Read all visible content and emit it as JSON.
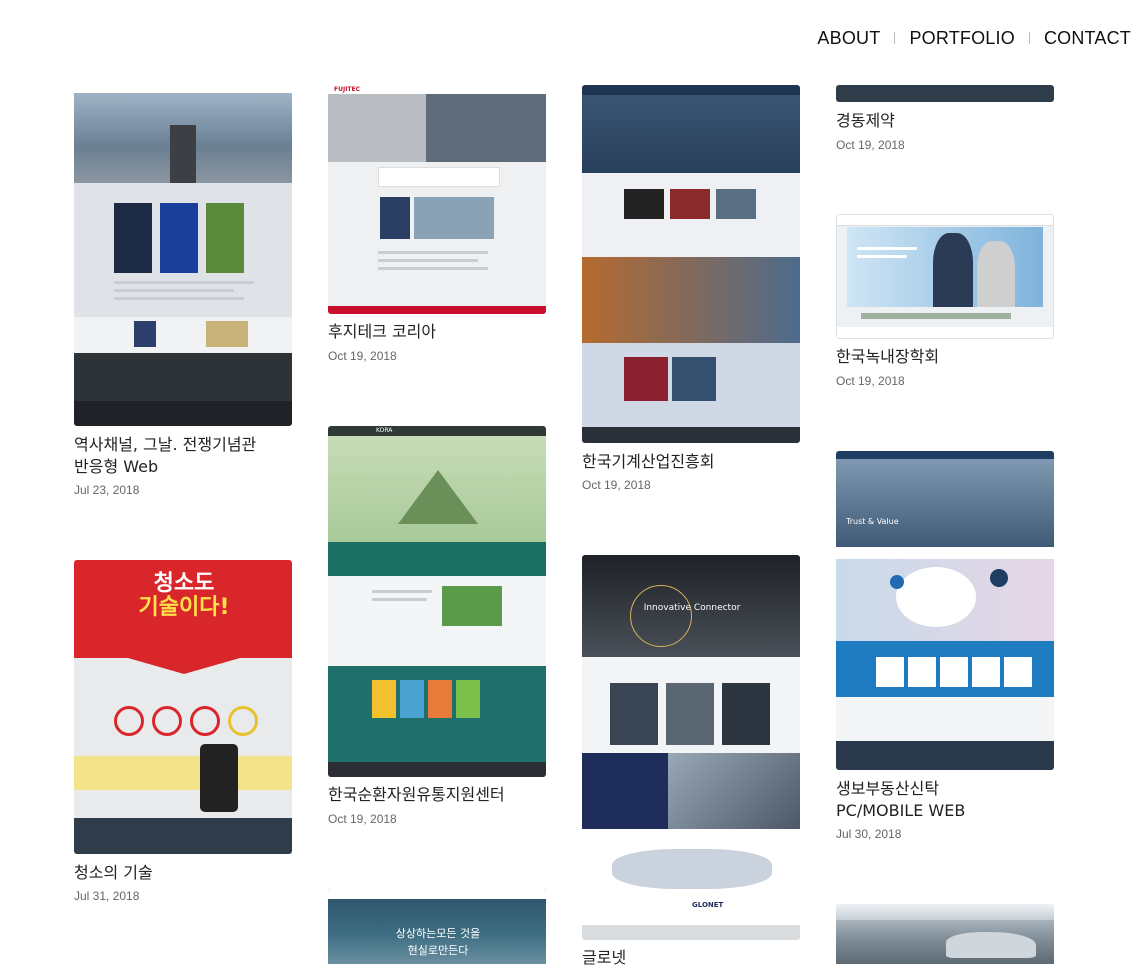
{
  "nav": {
    "about": "ABOUT",
    "portfolio": "PORTFOLIO",
    "contact": "CONTACT"
  },
  "cards": [
    {
      "title": "역사채널, 그날. 전쟁기념관\n반응형 Web",
      "date": "Jul 23, 2018"
    },
    {
      "title": "청소의 기술",
      "date": "Jul 31, 2018",
      "thumb_text": [
        "청소도",
        "기술이다!"
      ]
    },
    {
      "title": "후지테크 코리아",
      "date": "Oct 19, 2018",
      "thumb_text": [
        "FUJITEC"
      ]
    },
    {
      "title": "한국순환자원유통지원센터",
      "date": "Oct 19, 2018",
      "thumb_text": [
        "KORA"
      ]
    },
    {
      "title": "",
      "date": "",
      "thumb_text": [
        "상상하는모든 것을",
        "현실로만든다"
      ]
    },
    {
      "title": "한국기계산업진흥회",
      "date": "Oct 19, 2018"
    },
    {
      "title": "글로넷",
      "date": "",
      "thumb_text": [
        "Innovative Connector",
        "GLONET"
      ]
    },
    {
      "title": "경동제약",
      "date": "Oct 19, 2018"
    },
    {
      "title": "한국녹내장학회",
      "date": "Oct 19, 2018"
    },
    {
      "title": "생보부동산신탁\nPC/MOBILE WEB",
      "date": "Jul 30, 2018",
      "thumb_text": [
        "Trust & Value"
      ]
    }
  ],
  "colors": {
    "accent_red": "#d9262b",
    "dark_slate": "#2f3d4b",
    "teal": "#1f6f6a",
    "blue": "#1f7cc0"
  }
}
